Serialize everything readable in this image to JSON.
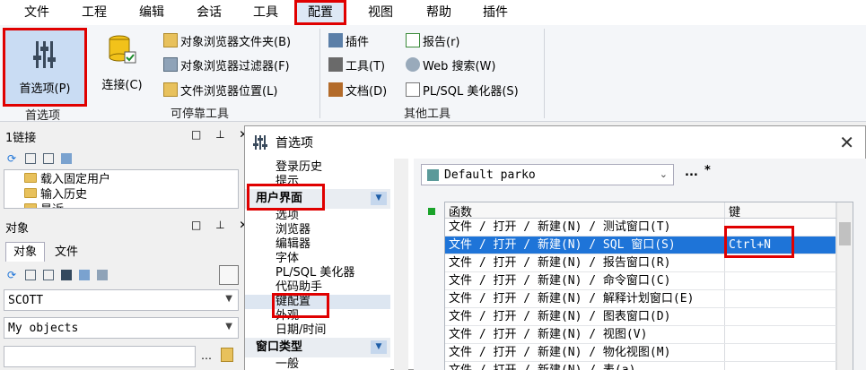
{
  "menubar": {
    "items": [
      {
        "label": "文件"
      },
      {
        "label": "工程"
      },
      {
        "label": "编辑"
      },
      {
        "label": "会话"
      },
      {
        "label": "工具"
      },
      {
        "label": "配置"
      },
      {
        "label": "视图"
      },
      {
        "label": "帮助"
      },
      {
        "label": "插件"
      }
    ]
  },
  "ribbon": {
    "preferences_label": "首选项(P)",
    "preferences_group": "首选项",
    "connect_label": "连接(C)",
    "dockable_group": "可停靠工具",
    "dockable": [
      {
        "label": "对象浏览器文件夹(B)"
      },
      {
        "label": "对象浏览器过滤器(F)"
      },
      {
        "label": "文件浏览器位置(L)"
      }
    ],
    "other_group": "其他工具",
    "other_col1": [
      {
        "label": "插件"
      },
      {
        "label": "工具(T)"
      },
      {
        "label": "文档(D)"
      }
    ],
    "other_col2": [
      {
        "label": "报告(r)"
      },
      {
        "label": "Web 搜索(W)"
      },
      {
        "label": "PL/SQL 美化器(S)"
      }
    ]
  },
  "left": {
    "links_title": "1链接",
    "links_tree": [
      "载入固定用户",
      "输入历史",
      "最近"
    ],
    "objects_title": "对象",
    "tabs": [
      "对象",
      "文件"
    ],
    "user_combo": "SCOTT",
    "filter_combo": "My objects"
  },
  "dialog": {
    "title": "首选项",
    "close": "✕",
    "nav_top": [
      "登录历史",
      "提示"
    ],
    "nav_ui_header": "用户界面",
    "nav_ui": [
      "选项",
      "浏览器",
      "编辑器",
      "字体",
      "PL/SQL 美化器",
      "代码助手",
      "键配置",
      "外观",
      "日期/时间"
    ],
    "nav_window_header": "窗口类型",
    "nav_window": [
      "一般"
    ],
    "profile_value": "Default parko",
    "profile_more": "...",
    "profile_star": "*",
    "table": {
      "col_function": "函数",
      "col_key": "键",
      "rows": [
        {
          "func": "文件 / 打开 / 新建(N) / 测试窗口(T)",
          "key": ""
        },
        {
          "func": "文件 / 打开 / 新建(N) / SQL 窗口(S)",
          "key": "Ctrl+N"
        },
        {
          "func": "文件 / 打开 / 新建(N) / 报告窗口(R)",
          "key": ""
        },
        {
          "func": "文件 / 打开 / 新建(N) / 命令窗口(C)",
          "key": ""
        },
        {
          "func": "文件 / 打开 / 新建(N) / 解释计划窗口(E)",
          "key": ""
        },
        {
          "func": "文件 / 打开 / 新建(N) / 图表窗口(D)",
          "key": ""
        },
        {
          "func": "文件 / 打开 / 新建(N) / 视图(V)",
          "key": ""
        },
        {
          "func": "文件 / 打开 / 新建(N) / 物化视图(M)",
          "key": ""
        },
        {
          "func": "文件 / 打开 / 新建(N) / 表(a)",
          "key": ""
        }
      ]
    }
  },
  "colors": {
    "highlight": "#e00000",
    "selection": "#1e74d8",
    "accent": "#1e5ea8"
  }
}
